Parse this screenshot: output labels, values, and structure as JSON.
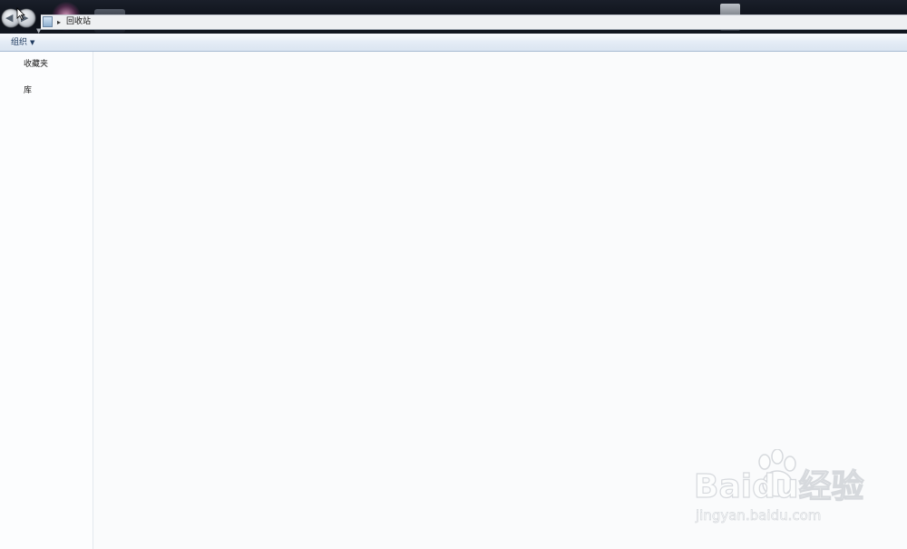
{
  "address": {
    "path": "回收站"
  },
  "toolbar": {
    "organize_label": "组织"
  },
  "navigation": {
    "items": [
      {
        "label": "收藏夹"
      },
      {
        "label": "库"
      }
    ]
  },
  "watermark": {
    "brand": "Baidu经验",
    "url": "jingyan.baidu.com"
  },
  "icons": {
    "back": "back-arrow-icon",
    "forward": "forward-arrow-icon",
    "recycle_bin": "recycle-bin-icon",
    "breadcrumb_separator": "chevron-right-icon",
    "organize_caret": "chevron-down-icon"
  }
}
